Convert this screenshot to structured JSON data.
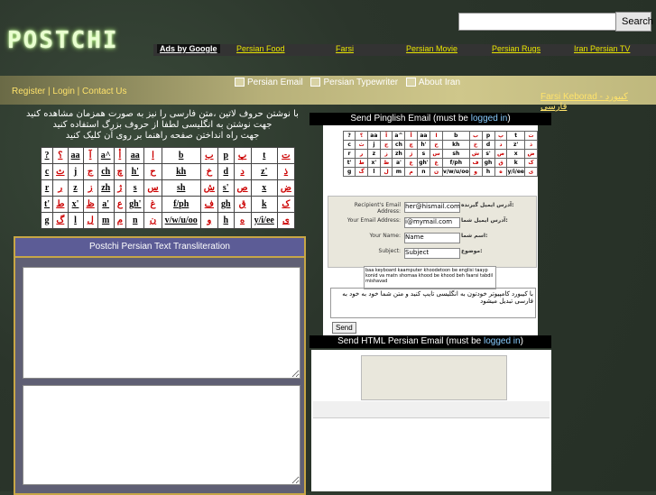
{
  "header": {
    "logo": "POSTCHI",
    "search_label": "Search",
    "search_value": ""
  },
  "adbar": {
    "label": "Ads by Google",
    "links": [
      "Persian Food",
      "Farsi",
      "Persian Movie",
      "Persian Rugs",
      "Iran Persian TV"
    ]
  },
  "nav": {
    "items": [
      "Persian Email",
      "Persian Typewriter",
      "About Iran"
    ],
    "farsi_keyboard": "Farsi Keborad - کیبورد فارسی"
  },
  "account": {
    "register": "Register",
    "login": "Login",
    "contact": "Contact Us"
  },
  "instructions": {
    "line1": "با نوشتن حروف لاتین ،متن فارسی را نیز به صورت همزمان مشاهده کنید",
    "line2": "جهت نوشتن به انگلیسی لطفا از حروف بزرگ استفاده کنید",
    "line3": "جهت راه انداختن صفحه راهنما بر روی آن کلیک کنید"
  },
  "keyboard": {
    "rows": [
      [
        [
          "?",
          "؟"
        ],
        [
          "aa",
          "آ"
        ],
        [
          "a^",
          "أ"
        ],
        [
          "aa",
          "ا"
        ],
        [
          "b",
          "ب"
        ],
        [
          "p",
          "پ"
        ],
        [
          "t",
          "ت"
        ]
      ],
      [
        [
          "c",
          "ث"
        ],
        [
          "j",
          "ج"
        ],
        [
          "ch",
          "چ"
        ],
        [
          "h'",
          "ح"
        ],
        [
          "kh",
          "خ"
        ],
        [
          "d",
          "د"
        ],
        [
          "z'",
          "ذ"
        ]
      ],
      [
        [
          "r",
          "ر"
        ],
        [
          "z",
          "ز"
        ],
        [
          "zh",
          "ژ"
        ],
        [
          "s",
          "س"
        ],
        [
          "sh",
          "ش"
        ],
        [
          "s'",
          "ص"
        ],
        [
          "x",
          "ض"
        ]
      ],
      [
        [
          "t'",
          "ط"
        ],
        [
          "x'",
          "ظ"
        ],
        [
          "a'",
          "ع"
        ],
        [
          "gh'",
          "غ"
        ],
        [
          "f/ph",
          "ف"
        ],
        [
          "gh",
          "ق"
        ],
        [
          "k",
          "ک"
        ]
      ],
      [
        [
          "g",
          "گ"
        ],
        [
          "l",
          "ل"
        ],
        [
          "m",
          "م"
        ],
        [
          "n",
          "ن"
        ],
        [
          "v/w/u/oo",
          "و"
        ],
        [
          "h",
          "ه"
        ],
        [
          "y/i/ee",
          "ی"
        ]
      ]
    ]
  },
  "translit": {
    "title": "Postchi Persian Text Transliteration"
  },
  "pinglish": {
    "title_pre": "Send Pinglish Email (must be ",
    "title_link": "logged in",
    "title_post": ")",
    "form": [
      {
        "label": "Recipient's Email Address:",
        "value": "her@hismail.com",
        "farsi": "آدرس ایمیل گیرنده:"
      },
      {
        "label": "Your Email Address:",
        "value": "i@mymail.com",
        "farsi": "آدرس ایمیل شما:"
      },
      {
        "label": "Your Name:",
        "value": "Name",
        "farsi": "اسم شما:"
      },
      {
        "label": "Subject:",
        "value": "Subject",
        "farsi": "موضوع:"
      }
    ],
    "message": "baa keyboard kaamputer khoodetoon be englisi taayp konid va matn shomaa khood be khood beh faarsi tabdil mishavad",
    "output": "با کیبورد کامپیوتر خودتون به انگلیسی تایپ کنید و متن شما خود به خود به فارسی تبدیل میشود",
    "send": "Send"
  },
  "html_email": {
    "title_pre": "Send HTML Persian Email (must be ",
    "title_link": "logged in",
    "title_post": ")"
  }
}
